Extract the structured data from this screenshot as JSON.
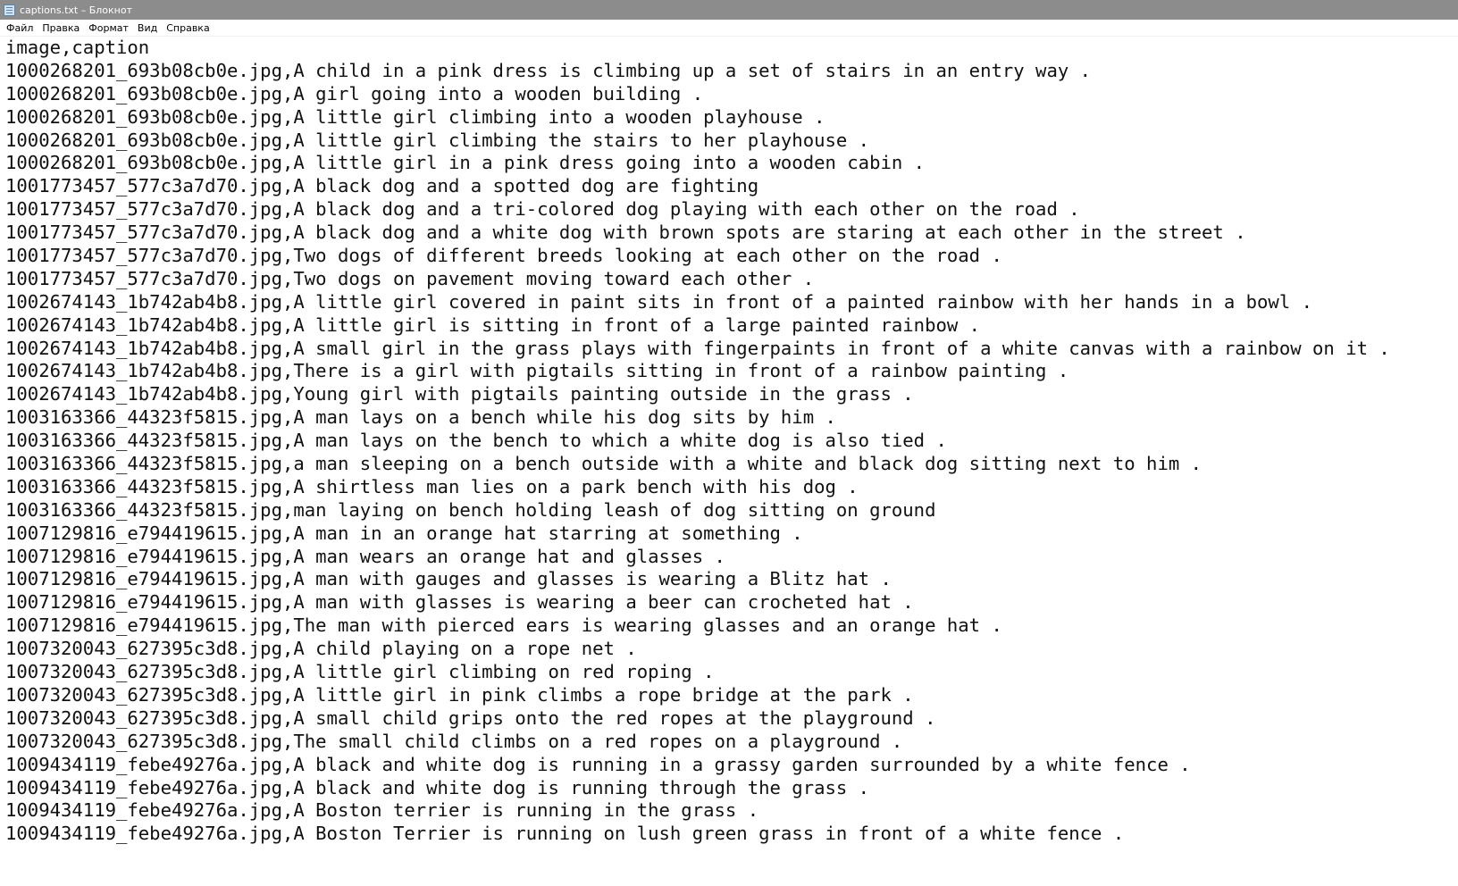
{
  "window": {
    "title": "captions.txt – Блокнот",
    "icon": "notepad-icon"
  },
  "menu": [
    "Файл",
    "Правка",
    "Формат",
    "Вид",
    "Справка"
  ],
  "content": {
    "lines": [
      "image,caption",
      "1000268201_693b08cb0e.jpg,A child in a pink dress is climbing up a set of stairs in an entry way .",
      "1000268201_693b08cb0e.jpg,A girl going into a wooden building .",
      "1000268201_693b08cb0e.jpg,A little girl climbing into a wooden playhouse .",
      "1000268201_693b08cb0e.jpg,A little girl climbing the stairs to her playhouse .",
      "1000268201_693b08cb0e.jpg,A little girl in a pink dress going into a wooden cabin .",
      "1001773457_577c3a7d70.jpg,A black dog and a spotted dog are fighting",
      "1001773457_577c3a7d70.jpg,A black dog and a tri-colored dog playing with each other on the road .",
      "1001773457_577c3a7d70.jpg,A black dog and a white dog with brown spots are staring at each other in the street .",
      "1001773457_577c3a7d70.jpg,Two dogs of different breeds looking at each other on the road .",
      "1001773457_577c3a7d70.jpg,Two dogs on pavement moving toward each other .",
      "1002674143_1b742ab4b8.jpg,A little girl covered in paint sits in front of a painted rainbow with her hands in a bowl .",
      "1002674143_1b742ab4b8.jpg,A little girl is sitting in front of a large painted rainbow .",
      "1002674143_1b742ab4b8.jpg,A small girl in the grass plays with fingerpaints in front of a white canvas with a rainbow on it .",
      "1002674143_1b742ab4b8.jpg,There is a girl with pigtails sitting in front of a rainbow painting .",
      "1002674143_1b742ab4b8.jpg,Young girl with pigtails painting outside in the grass .",
      "1003163366_44323f5815.jpg,A man lays on a bench while his dog sits by him .",
      "1003163366_44323f5815.jpg,A man lays on the bench to which a white dog is also tied .",
      "1003163366_44323f5815.jpg,a man sleeping on a bench outside with a white and black dog sitting next to him .",
      "1003163366_44323f5815.jpg,A shirtless man lies on a park bench with his dog .",
      "1003163366_44323f5815.jpg,man laying on bench holding leash of dog sitting on ground",
      "1007129816_e794419615.jpg,A man in an orange hat starring at something .",
      "1007129816_e794419615.jpg,A man wears an orange hat and glasses .",
      "1007129816_e794419615.jpg,A man with gauges and glasses is wearing a Blitz hat .",
      "1007129816_e794419615.jpg,A man with glasses is wearing a beer can crocheted hat .",
      "1007129816_e794419615.jpg,The man with pierced ears is wearing glasses and an orange hat .",
      "1007320043_627395c3d8.jpg,A child playing on a rope net .",
      "1007320043_627395c3d8.jpg,A little girl climbing on red roping .",
      "1007320043_627395c3d8.jpg,A little girl in pink climbs a rope bridge at the park .",
      "1007320043_627395c3d8.jpg,A small child grips onto the red ropes at the playground .",
      "1007320043_627395c3d8.jpg,The small child climbs on a red ropes on a playground .",
      "1009434119_febe49276a.jpg,A black and white dog is running in a grassy garden surrounded by a white fence .",
      "1009434119_febe49276a.jpg,A black and white dog is running through the grass .",
      "1009434119_febe49276a.jpg,A Boston terrier is running in the grass .",
      "1009434119_febe49276a.jpg,A Boston Terrier is running on lush green grass in front of a white fence ."
    ]
  }
}
